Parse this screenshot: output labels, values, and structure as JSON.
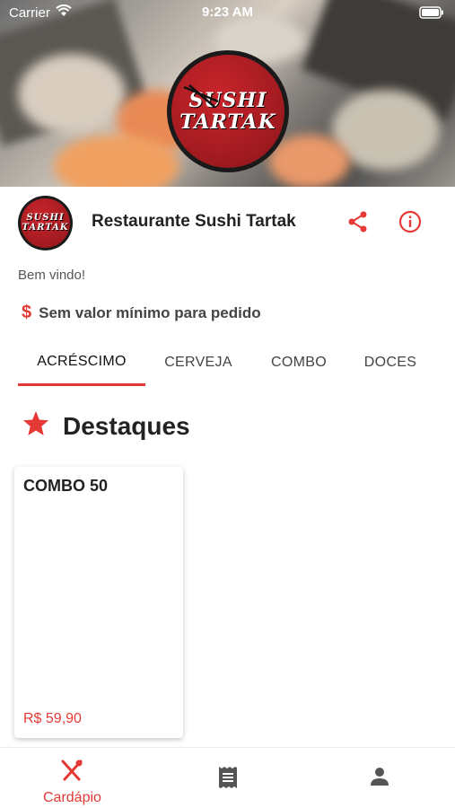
{
  "status_bar": {
    "carrier": "Carrier",
    "time": "9:23 AM"
  },
  "hero": {
    "logo_line1": "SUSHI",
    "logo_line2": "TARTAK"
  },
  "restaurant": {
    "name": "Restaurante Sushi Tartak",
    "logo_line1": "SUSHI",
    "logo_line2": "TARTAK"
  },
  "welcome": "Bem vindo!",
  "minimum_order": {
    "symbol": "$",
    "text": "Sem valor mínimo para pedido"
  },
  "tabs": [
    {
      "label": "ACRÉSCIMO",
      "active": true
    },
    {
      "label": "CERVEJA"
    },
    {
      "label": "COMBO"
    },
    {
      "label": "DOCES"
    }
  ],
  "section": {
    "title": "Destaques"
  },
  "products": [
    {
      "name": "COMBO 50",
      "price": "R$ 59,90"
    }
  ],
  "bottom_nav": {
    "menu_label": "Cardápio"
  },
  "colors": {
    "accent": "#e53935",
    "logo_red": "#9e1a1f"
  }
}
